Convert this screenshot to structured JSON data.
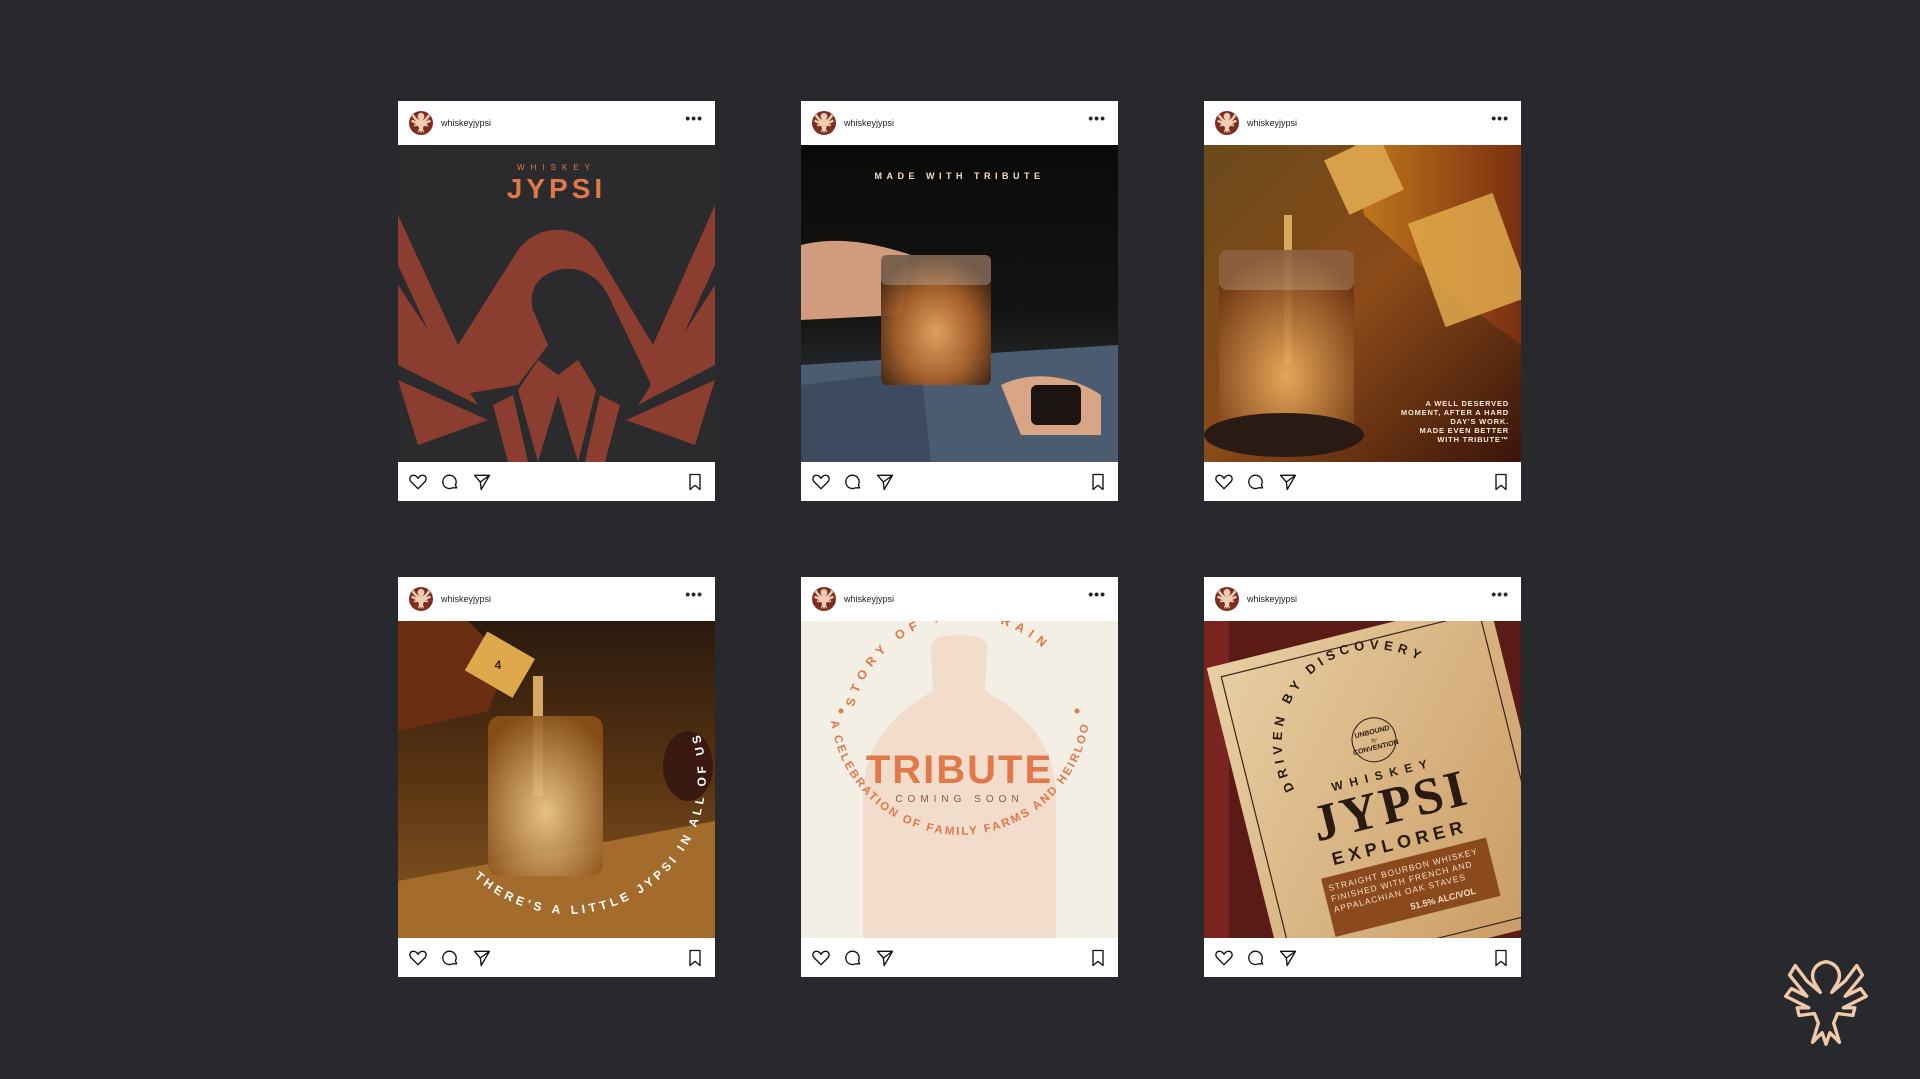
{
  "account": {
    "username": "whiskeyjypsi",
    "more_label": "•••"
  },
  "posts": [
    {
      "id": "post-1",
      "kicker": "WHISKEY",
      "title": "JYPSI"
    },
    {
      "id": "post-2",
      "headline": "MADE WITH TRIBUTE"
    },
    {
      "id": "post-3",
      "caption_lines": [
        "A WELL DESERVED",
        "MOMENT, AFTER A HARD",
        "DAY'S WORK.",
        "MADE EVEN BETTER",
        "WITH TRIBUTE™"
      ]
    },
    {
      "id": "post-4",
      "arc_text": "THERE'S A LITTLE JYPSI IN ALL OF US",
      "bottle_label": "4"
    },
    {
      "id": "post-5",
      "arc_top": "STORY OF THE GRAIN",
      "arc_bottom": "A CELEBRATION OF FAMILY FARMS AND HEIRLOOM GRAINS",
      "title": "TRIBUTE",
      "subtitle": "COMING SOON"
    },
    {
      "id": "post-6",
      "label_arc": "DRIVEN BY DISCOVERY",
      "badge_lines": [
        "UNBOUND",
        "by",
        "CONVENTION"
      ],
      "kicker": "WHISKEY",
      "title": "JYPSI",
      "subtitle": "EXPLORER",
      "fine_print": [
        "STRAIGHT BOURBON WHISKEY",
        "FINISHED WITH FRENCH AND",
        "APPALACHIAN OAK STAVES"
      ],
      "abv": "51.5% ALC/VOL"
    }
  ],
  "icons": [
    "heart-icon",
    "comment-icon",
    "share-icon",
    "bookmark-icon",
    "more-icon",
    "eagle-logo-icon"
  ],
  "colors": {
    "background": "#28292d",
    "brand_rust": "#8b3d2f",
    "brand_orange": "#e0784a",
    "cream": "#f3efe4",
    "peach": "#f0c9a8"
  }
}
